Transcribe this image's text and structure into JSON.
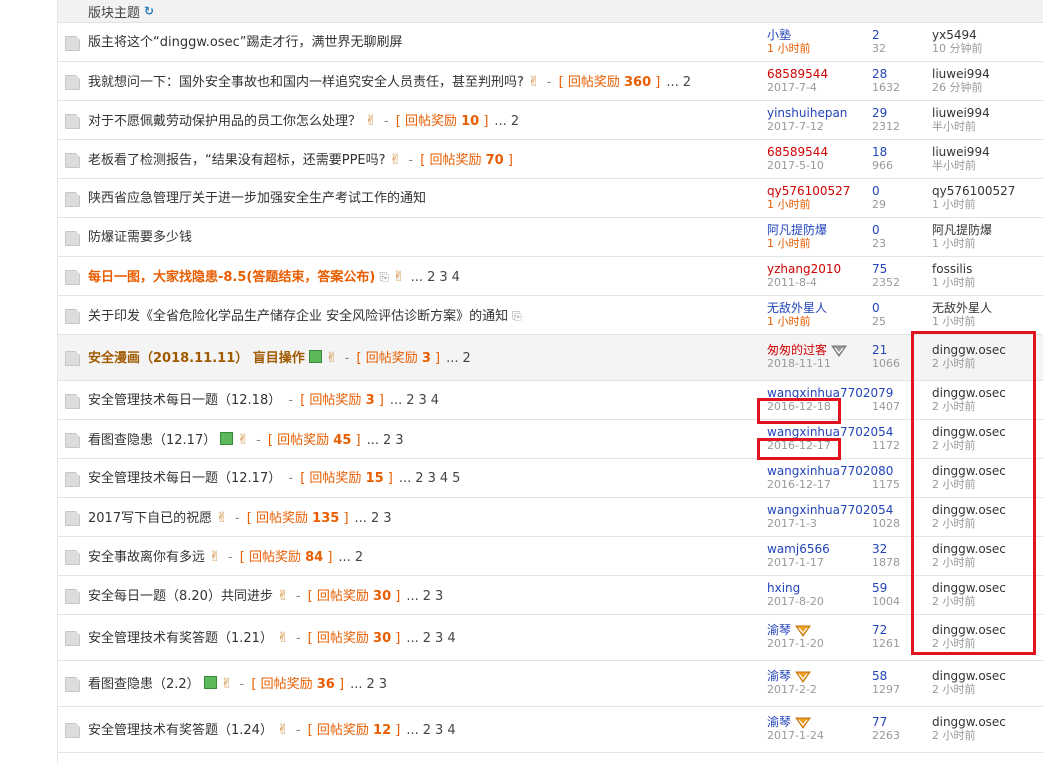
{
  "header": {
    "title": "版块主题",
    "refresh_icon": "refresh-icon"
  },
  "threads": [
    {
      "title": "版主将这个“dinggw.osec”踢走才行，满世界无聊刷屏",
      "author": "小塾",
      "author_date": "1 小时前",
      "replies": "2",
      "views": "32",
      "last_user": "yx5494",
      "last_time": "10 分钟前"
    },
    {
      "title": "我就想问一下：国外安全事故也和国内一样追究安全人员责任，甚至判刑吗?",
      "reward_label": "回帖奖励",
      "reward": "360",
      "pages": [
        "2"
      ],
      "author": "68589544",
      "author_date": "2017-7-4",
      "replies": "28",
      "views": "1632",
      "last_user": "liuwei994",
      "last_time": "26 分钟前"
    },
    {
      "title": "对于不愿佩戴劳动保护用品的员工你怎么处理？",
      "reward_label": "回帖奖励",
      "reward": "10",
      "pages": [
        "2"
      ],
      "author": "yinshuihepan",
      "author_date": "2017-7-12",
      "replies": "29",
      "views": "2312",
      "last_user": "liuwei994",
      "last_time": "半小时前"
    },
    {
      "title": "老板看了检测报告，“结果没有超标，还需要PPE吗?",
      "reward_label": "回帖奖励",
      "reward": "70",
      "pages": [],
      "author": "68589544",
      "author_date": "2017-5-10",
      "replies": "18",
      "views": "966",
      "last_user": "liuwei994",
      "last_time": "半小时前"
    },
    {
      "title": "陕西省应急管理厅关于进一步加强安全生产考试工作的通知",
      "author": "qy576100527",
      "author_date": "1 小时前",
      "replies": "0",
      "views": "29",
      "last_user": "qy576100527",
      "last_time": "1 小时前"
    },
    {
      "title": "防爆证需要多少钱",
      "author": "阿凡提防爆",
      "author_date": "1 小时前",
      "replies": "0",
      "views": "23",
      "last_user": "阿凡提防爆",
      "last_time": "1 小时前"
    },
    {
      "title": "每日一图，大家找隐患-8.5(答题结束，答案公布)",
      "pages": [
        "2",
        "3",
        "4"
      ],
      "author": "yzhang2010",
      "author_date": "2011-8-4",
      "replies": "75",
      "views": "2352",
      "last_user": "fossilis",
      "last_time": "1 小时前"
    },
    {
      "title": "关于印发《全省危险化学品生产储存企业 安全风险评估诊断方案》的通知",
      "author": "无敌外星人",
      "author_date": "1 小时前",
      "replies": "0",
      "views": "25",
      "last_user": "无敌外星人",
      "last_time": "1 小时前"
    },
    {
      "title": "安全漫画（2018.11.11） 盲目操作",
      "reward_label": "回帖奖励",
      "reward": "3",
      "pages": [
        "2"
      ],
      "author": "匆匆的过客",
      "author_date": "2018-11-11",
      "replies": "21",
      "views": "1066",
      "last_user": "dinggw.osec",
      "last_time": "2 小时前"
    },
    {
      "title": "安全管理技术每日一题（12.18）",
      "reward_label": "回帖奖励",
      "reward": "3",
      "pages": [
        "2",
        "3",
        "4"
      ],
      "author": "wangxinhua7702079",
      "author_date": "2016-12-18",
      "replies": "",
      "views": "1407",
      "last_user": "dinggw.osec",
      "last_time": "2 小时前"
    },
    {
      "title": "看图查隐患（12.17）",
      "reward_label": "回帖奖励",
      "reward": "45",
      "pages": [
        "2",
        "3"
      ],
      "author": "wangxinhua7702054",
      "author_date": "2016-12-17",
      "replies": "",
      "views": "1172",
      "last_user": "dinggw.osec",
      "last_time": "2 小时前"
    },
    {
      "title": "安全管理技术每日一题（12.17）",
      "reward_label": "回帖奖励",
      "reward": "15",
      "pages": [
        "2",
        "3",
        "4",
        "5"
      ],
      "author": "wangxinhua7702080",
      "author_date": "2016-12-17",
      "replies": "",
      "views": "1175",
      "last_user": "dinggw.osec",
      "last_time": "2 小时前"
    },
    {
      "title": "2017写下自已的祝愿",
      "reward_label": "回帖奖励",
      "reward": "135",
      "pages": [
        "2",
        "3"
      ],
      "author": "wangxinhua7702054",
      "author_date": "2017-1-3",
      "replies": "",
      "views": "1028",
      "last_user": "dinggw.osec",
      "last_time": "2 小时前"
    },
    {
      "title": "安全事故离你有多远",
      "reward_label": "回帖奖励",
      "reward": "84",
      "pages": [
        "2"
      ],
      "author": "wamj6566",
      "author_date": "2017-1-17",
      "replies": "32",
      "views": "1878",
      "last_user": "dinggw.osec",
      "last_time": "2 小时前"
    },
    {
      "title": "安全每日一题（8.20）共同进步",
      "reward_label": "回帖奖励",
      "reward": "30",
      "pages": [
        "2",
        "3"
      ],
      "author": "hxing",
      "author_date": "2017-8-20",
      "replies": "59",
      "views": "1004",
      "last_user": "dinggw.osec",
      "last_time": "2 小时前"
    },
    {
      "title": "安全管理技术有奖答题（1.21）",
      "reward_label": "回帖奖励",
      "reward": "30",
      "pages": [
        "2",
        "3",
        "4"
      ],
      "author": "渝琴",
      "author_date": "2017-1-20",
      "replies": "72",
      "views": "1261",
      "last_user": "dinggw.osec",
      "last_time": "2 小时前"
    },
    {
      "title": "看图查隐患（2.2）",
      "reward_label": "回帖奖励",
      "reward": "36",
      "pages": [
        "2",
        "3"
      ],
      "author": "渝琴",
      "author_date": "2017-2-2",
      "replies": "58",
      "views": "1297",
      "last_user": "dinggw.osec",
      "last_time": "2 小时前"
    },
    {
      "title": "安全管理技术有奖答题（1.24）",
      "reward_label": "回帖奖励",
      "reward": "12",
      "pages": [
        "2",
        "3",
        "4"
      ],
      "author": "渝琴",
      "author_date": "2017-1-24",
      "replies": "77",
      "views": "2263",
      "last_user": "dinggw.osec",
      "last_time": "2 小时前"
    }
  ],
  "colors": {
    "highlight": "#e0141e",
    "link_blue": "#2244bb",
    "reward_orange": "#e85d00"
  }
}
